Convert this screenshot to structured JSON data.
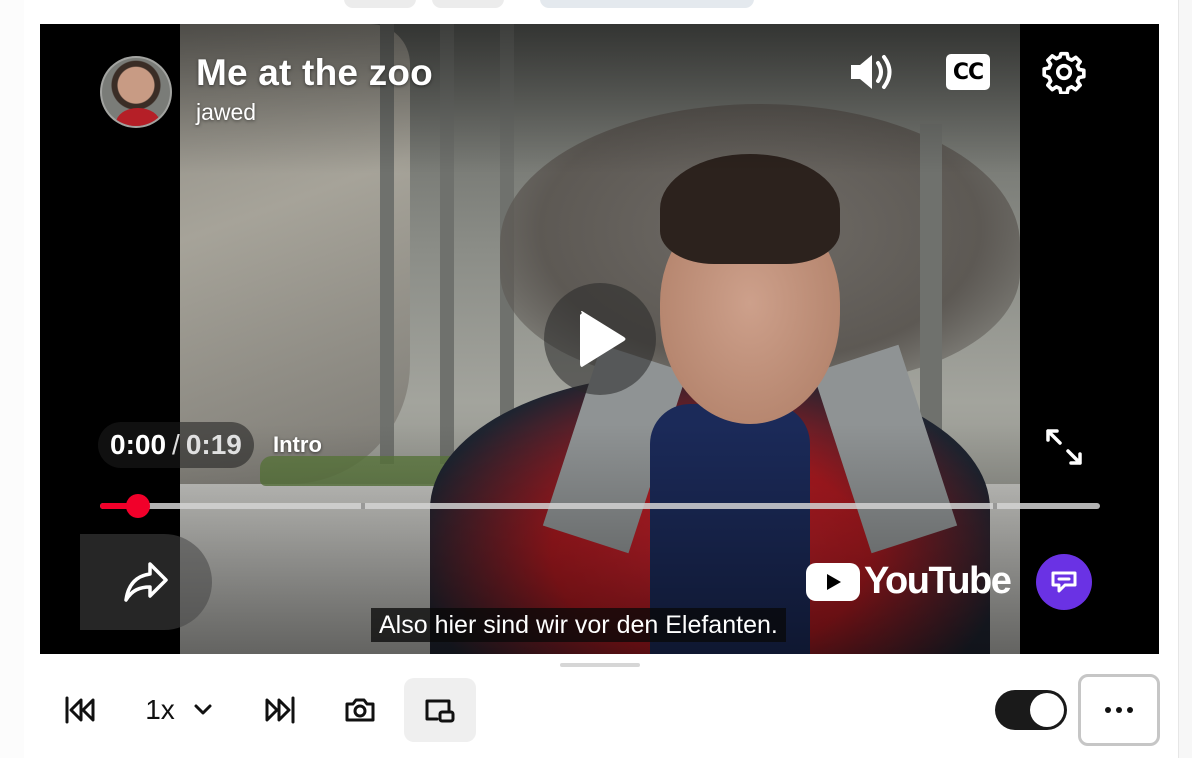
{
  "video": {
    "title": "Me at the zoo",
    "channel": "jawed",
    "current_time": "0:00",
    "time_separator": "/",
    "duration": "0:19",
    "chapter": "Intro",
    "subtitle": "Also hier sind wir vor den Elefanten.",
    "progress_fraction": 0.038,
    "logo_text": "YouTube"
  },
  "controls": {
    "volume_icon": "volume-high-icon",
    "captions_label": "CC",
    "settings_icon": "gear-icon",
    "play_icon": "play-icon",
    "fullscreen_icon": "expand-icon",
    "share_icon": "share-icon",
    "assistant_icon": "chat-assistant-icon"
  },
  "toolbar": {
    "rewind_icon": "skip-back-icon",
    "speed_label": "1x",
    "forward_icon": "skip-forward-icon",
    "screenshot_icon": "camera-icon",
    "pip_icon": "picture-in-picture-icon",
    "toggle_on": true,
    "more_icon": "more-horizontal-icon"
  },
  "colors": {
    "progress": "#f1002a",
    "assistant": "#6a32e4",
    "toggle": "#1a1a1a"
  }
}
